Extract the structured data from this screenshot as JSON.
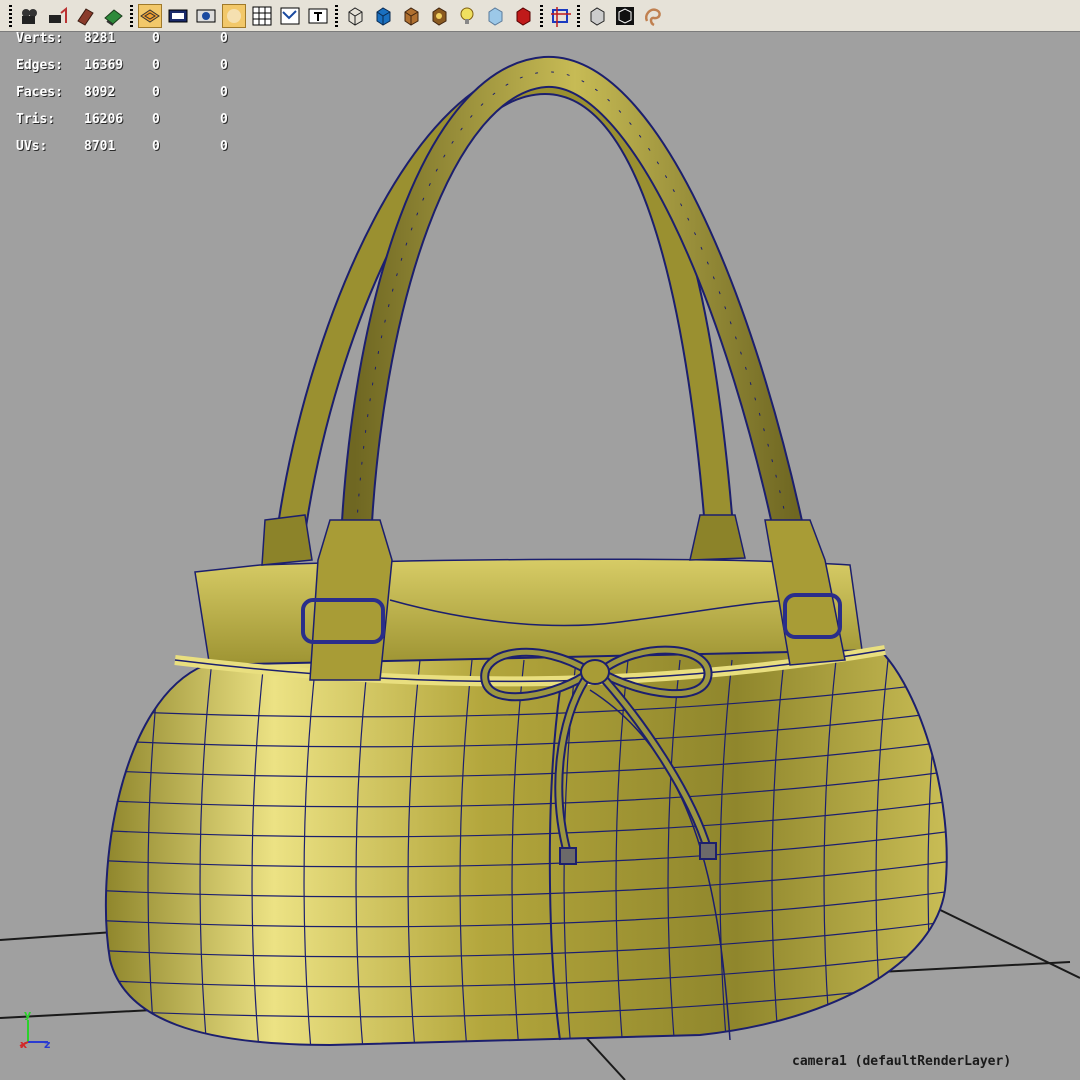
{
  "toolbar": {
    "groups": [
      [
        "camera-attributes-icon",
        "camera-tools-icon",
        "bookmark-icon",
        "image-plane-icon"
      ],
      [
        "wireframe-on-shaded-icon",
        "resolution-gate-icon",
        "film-gate-icon",
        "smooth-shade-icon",
        "grid-icon",
        "uv-texture-icon",
        "text-icon"
      ],
      [
        "wireframe-cube-icon",
        "shaded-cube-icon",
        "textured-cube-icon",
        "use-all-lights-icon",
        "light-bulb-icon",
        "xray-icon",
        "shadow-icon"
      ],
      [
        "isolate-select-icon"
      ],
      [
        "backface-cube-icon",
        "frame-all-icon",
        "lasso-icon"
      ]
    ],
    "active": [
      "wireframe-on-shaded-icon",
      "smooth-shade-icon"
    ]
  },
  "hud": {
    "rows": [
      {
        "label": "Verts:",
        "v1": "8281",
        "v2": "0",
        "v3": "0"
      },
      {
        "label": "Edges:",
        "v1": "16369",
        "v2": "0",
        "v3": "0"
      },
      {
        "label": "Faces:",
        "v1": "8092",
        "v2": "0",
        "v3": "0"
      },
      {
        "label": "Tris:",
        "v1": "16206",
        "v2": "0",
        "v3": "0"
      },
      {
        "label": "UVs:",
        "v1": "8701",
        "v2": "0",
        "v3": "0"
      }
    ]
  },
  "axis": {
    "y": "y",
    "x": "x",
    "z": "z"
  },
  "camera_label": "camera1 (defaultRenderLayer)",
  "colors": {
    "viewport_bg": "#a0a0a0",
    "mesh_fill": "#b3a63c",
    "mesh_light": "#efe58a",
    "mesh_dark": "#6a6220",
    "wire": "#1c1f6e",
    "grid": "#1a1a1a"
  }
}
